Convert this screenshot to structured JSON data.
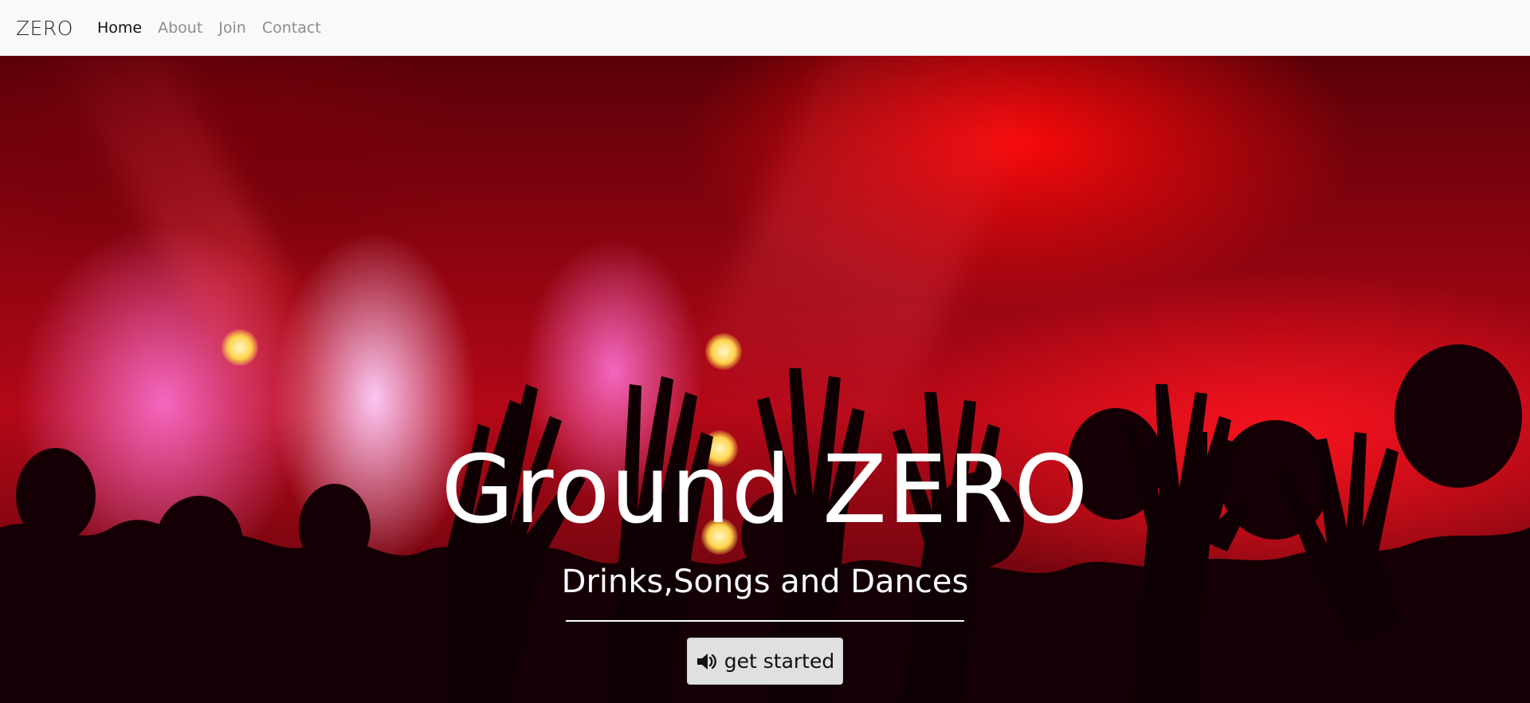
{
  "navbar": {
    "brand": "ZERO",
    "links": [
      {
        "label": "Home",
        "active": true
      },
      {
        "label": "About",
        "active": false
      },
      {
        "label": "Join",
        "active": false
      },
      {
        "label": "Contact",
        "active": false
      }
    ]
  },
  "hero": {
    "title": "Ground ZERO",
    "subtitle": "Drinks,Songs and Dances",
    "cta": {
      "label": "get started",
      "icon": "volume-up-icon"
    }
  },
  "colors": {
    "navbar_bg": "#f8f9fa",
    "nav_active": "#111111",
    "nav_inactive": "#8c8c8c",
    "hero_text": "#ffffff",
    "button_bg": "#e0e0e0"
  }
}
